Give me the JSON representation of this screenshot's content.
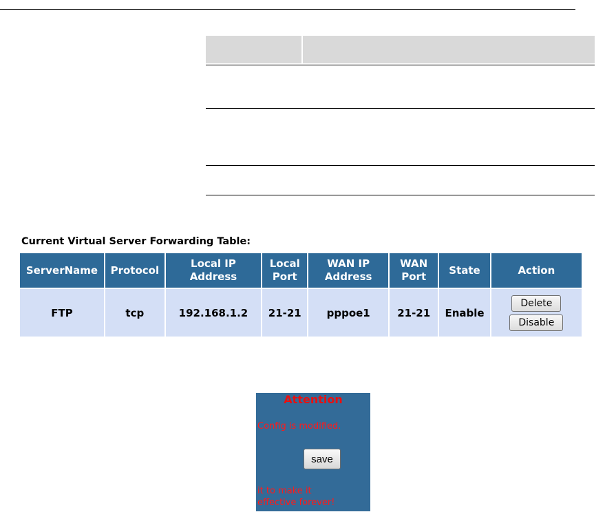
{
  "forwarding": {
    "title": "Current Virtual Server Forwarding Table:",
    "headers": {
      "server_name": "ServerName",
      "protocol": "Protocol",
      "local_ip_1": "Local IP",
      "local_ip_2": "Address",
      "local_port_1": "Local",
      "local_port_2": "Port",
      "wan_ip_1": "WAN IP",
      "wan_ip_2": "Address",
      "wan_port_1": "WAN",
      "wan_port_2": "Port",
      "state": "State",
      "action": "Action"
    },
    "rows": [
      {
        "server_name": "FTP",
        "protocol": "tcp",
        "local_ip": "192.168.1.2",
        "local_port": "21-21",
        "wan_ip": "pppoe1",
        "wan_port": "21-21",
        "state": "Enable",
        "delete_label": "Delete",
        "disable_label": "Disable"
      }
    ],
    "colors": {
      "header_bg": "#2e6a98",
      "row_bg": "#d4dff6"
    }
  },
  "attention": {
    "title": "Attention",
    "message": "Config is modified.",
    "save_label": "save",
    "note_line1": "it to make it",
    "note_line2": "effective forever!",
    "colors": {
      "box_bg": "#336b98",
      "text": "#ff1a1a"
    }
  }
}
